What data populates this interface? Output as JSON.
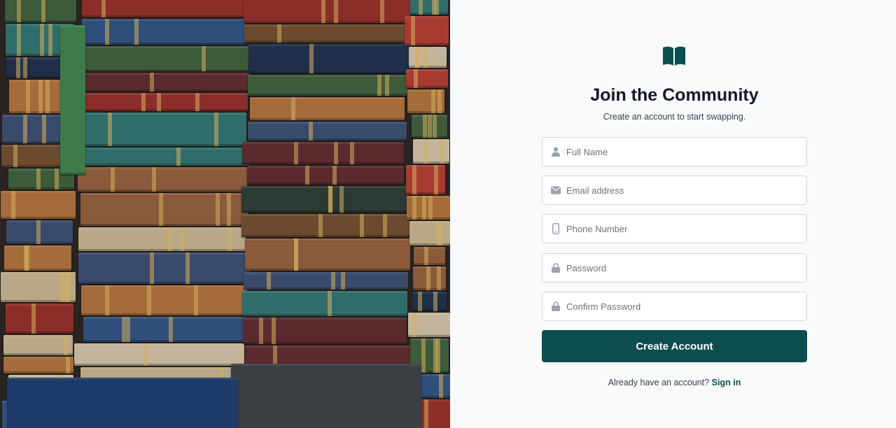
{
  "hero": {
    "image_description_icon": "stacked-books-photo"
  },
  "form": {
    "logo_icon": "open-book-icon",
    "title": "Join the Community",
    "subtitle": "Create an account to start swapping.",
    "fields": [
      {
        "icon": "user-icon",
        "placeholder": "Full Name",
        "value": ""
      },
      {
        "icon": "envelope-icon",
        "placeholder": "Email address",
        "value": ""
      },
      {
        "icon": "phone-icon",
        "placeholder": "Phone Number",
        "value": ""
      },
      {
        "icon": "lock-icon",
        "placeholder": "Password",
        "value": ""
      },
      {
        "icon": "lock-icon",
        "placeholder": "Confirm Password",
        "value": ""
      }
    ],
    "submit_label": "Create Account",
    "signin_prompt": "Already have an account?",
    "signin_link": "Sign in"
  },
  "colors": {
    "brand": "#0d4d4d",
    "background": "#f8fafc",
    "input_border": "#d1d5db",
    "icon": "#9ca3af"
  }
}
